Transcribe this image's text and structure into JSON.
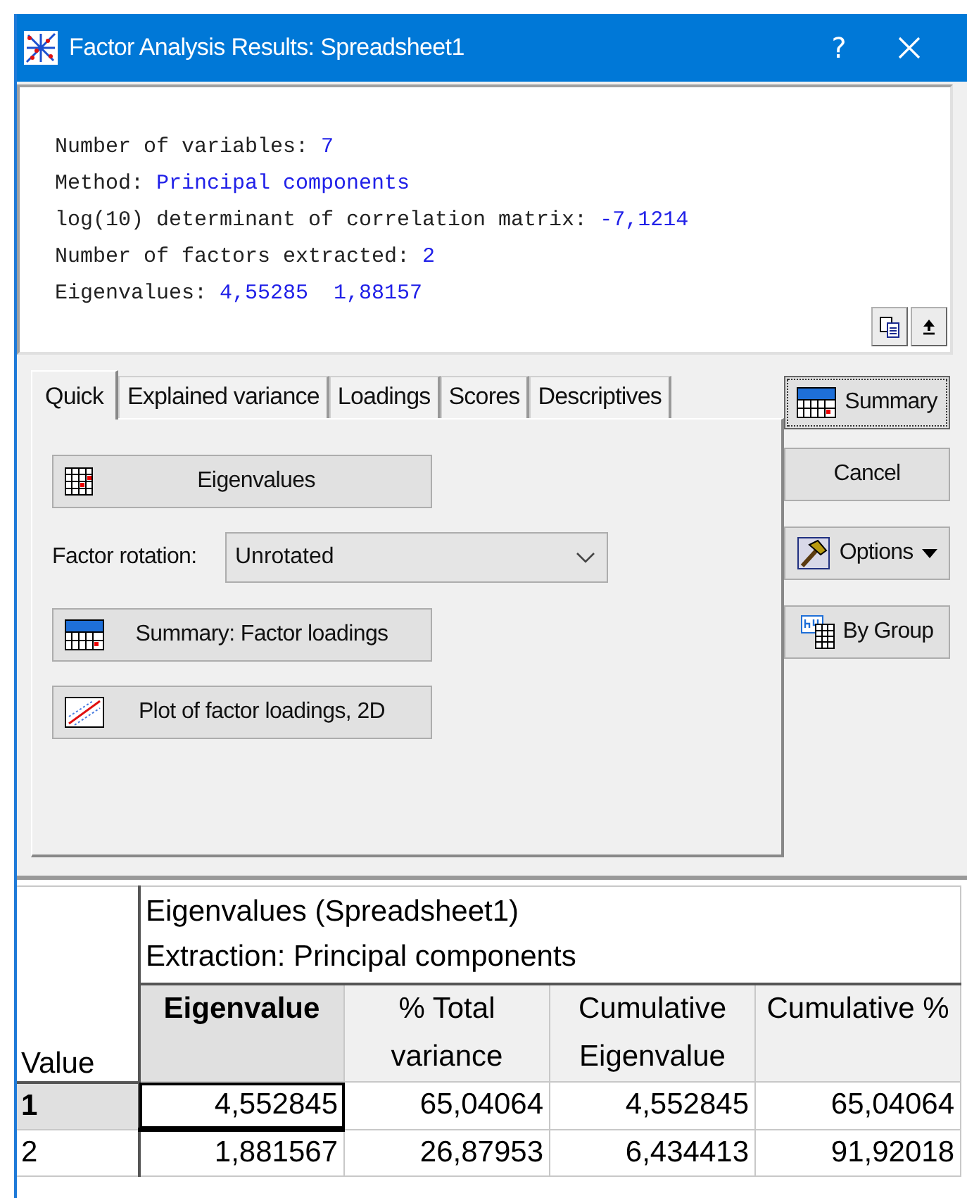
{
  "window": {
    "title": "Factor Analysis Results: Spreadsheet1",
    "help_button": "?"
  },
  "info_lines": [
    {
      "label": "Number of variables:",
      "value": "7"
    },
    {
      "label": "Method:",
      "value": "Principal components"
    },
    {
      "label": "log(10) determinant of correlation matrix:",
      "value": "-7,1214"
    },
    {
      "label": "Number of factors extracted:",
      "value": "2"
    },
    {
      "label": "Eigenvalues:",
      "value": "4,55285  1,88157"
    }
  ],
  "tabs": [
    {
      "label": "Quick",
      "selected": true
    },
    {
      "label": "Explained variance",
      "selected": false
    },
    {
      "label": "Loadings",
      "selected": false
    },
    {
      "label": "Scores",
      "selected": false
    },
    {
      "label": "Descriptives",
      "selected": false
    }
  ],
  "quick": {
    "eigen_button": "Eigenvalues",
    "rotation_label": "Factor rotation:",
    "rotation_value": "Unrotated",
    "summary_button": "Summary: Factor loadings",
    "plot_button": "Plot of factor loadings, 2D"
  },
  "side_buttons": [
    {
      "kind": "summary",
      "label": "Summary"
    },
    {
      "kind": "plain",
      "label": "Cancel"
    },
    {
      "kind": "options",
      "label": "Options"
    },
    {
      "kind": "bygroup",
      "label": "By Group"
    }
  ],
  "sheet": {
    "title_lines": [
      "Eigenvalues (Spreadsheet1)",
      "Extraction: Principal components"
    ],
    "row_header_title": "Value",
    "columns": [
      {
        "label": "Eigenvalue",
        "selected": true
      },
      {
        "label": "% Total variance",
        "selected": false
      },
      {
        "label": "Cumulative Eigenvalue",
        "selected": false
      },
      {
        "label": "Cumulative %",
        "selected": false
      }
    ],
    "rows": [
      {
        "label": "1",
        "selected": true,
        "cells": [
          "4,552845",
          "65,04064",
          "4,552845",
          "65,04064"
        ]
      },
      {
        "label": "2",
        "selected": false,
        "cells": [
          "1,881567",
          "26,87953",
          "6,434413",
          "91,92018"
        ]
      }
    ]
  }
}
